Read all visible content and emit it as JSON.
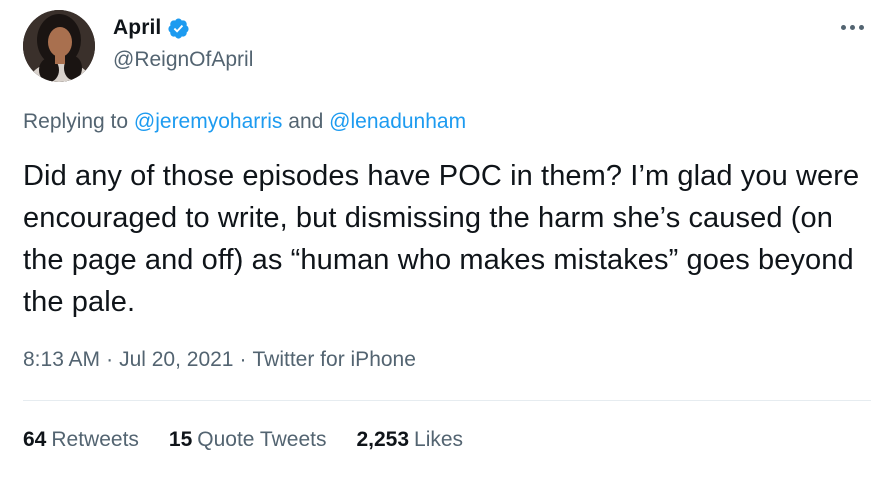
{
  "author": {
    "display_name": "April",
    "handle": "@ReignOfApril",
    "verified": true
  },
  "icons": {
    "verified": "verified-badge-icon",
    "more": "more-horizontal-icon",
    "verified_color": "#1d9bf0"
  },
  "reply": {
    "prefix": "Replying to",
    "mention_1": "@jeremyoharris",
    "conjunction": "and",
    "mention_2": "@lenadunham"
  },
  "tweet": {
    "text": "Did any of those episodes have POC in them? I’m glad you were encouraged to write, but dismissing the harm she’s caused (on the page and off) as “human who makes mistakes” goes beyond the pale."
  },
  "meta": {
    "time": "8:13 AM",
    "separator": "·",
    "date": "Jul 20, 2021",
    "source": "Twitter for iPhone"
  },
  "stats": {
    "retweets_count": "64",
    "retweets_label": "Retweets",
    "quotes_count": "15",
    "quotes_label": "Quote Tweets",
    "likes_count": "2,253",
    "likes_label": "Likes"
  },
  "colors": {
    "text": "#0f1419",
    "secondary": "#536471",
    "link": "#1d9bf0",
    "divider": "#e6ecf0"
  }
}
